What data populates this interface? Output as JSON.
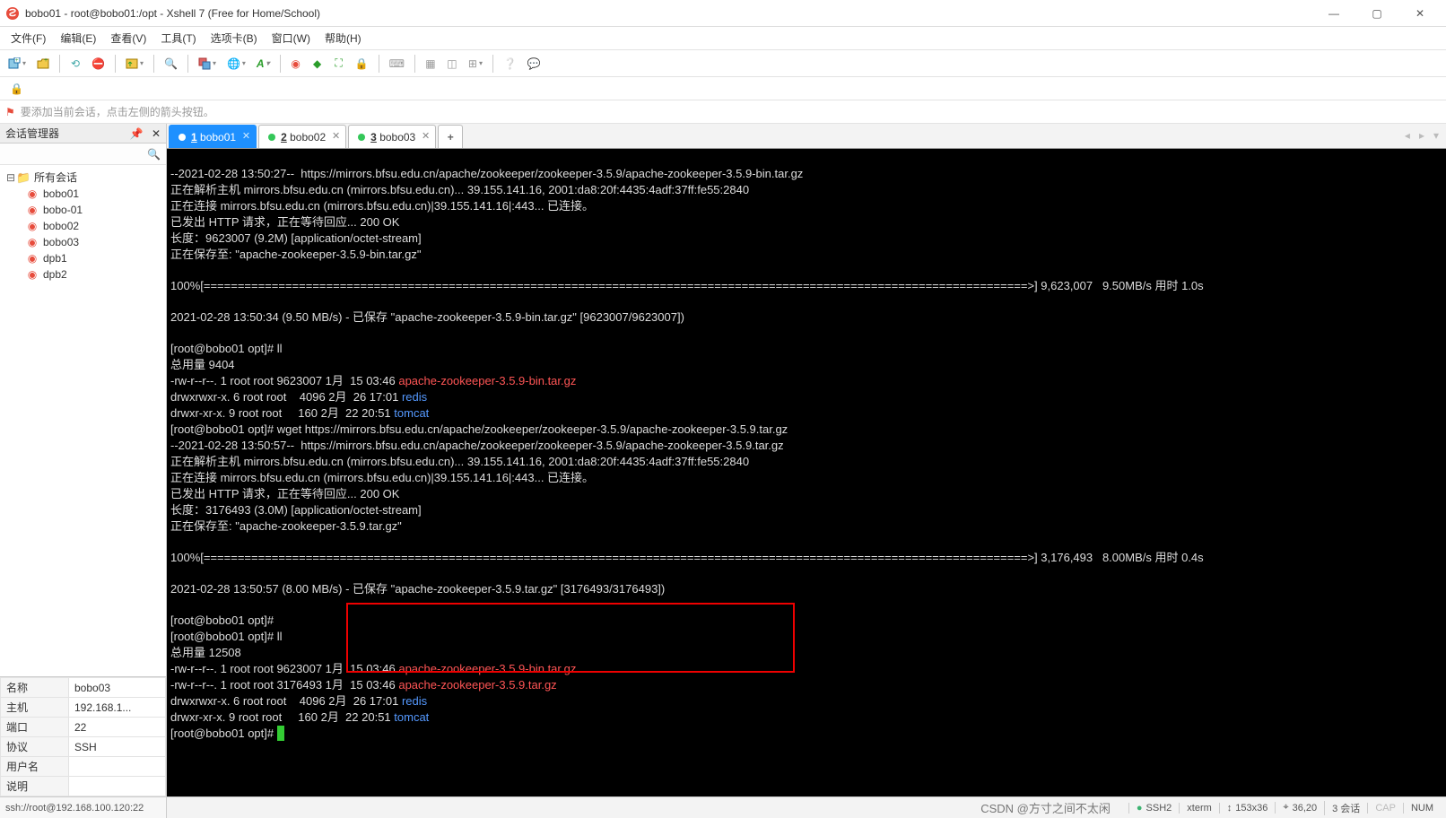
{
  "window": {
    "title": "bobo01 - root@bobo01:/opt - Xshell 7 (Free for Home/School)",
    "min": "—",
    "max": "▢",
    "close": "✕"
  },
  "menu": [
    "文件(F)",
    "编辑(E)",
    "查看(V)",
    "工具(T)",
    "选项卡(B)",
    "窗口(W)",
    "帮助(H)"
  ],
  "tipbar": "要添加当前会话，点击左侧的箭头按钮。",
  "panel": {
    "title": "会话管理器"
  },
  "tree": {
    "root": "所有会话",
    "items": [
      "bobo01",
      "bobo-01",
      "bobo02",
      "bobo03",
      "dpb1",
      "dpb2"
    ]
  },
  "props": {
    "rows": [
      {
        "k": "名称",
        "v": "bobo03"
      },
      {
        "k": "主机",
        "v": "192.168.1..."
      },
      {
        "k": "端口",
        "v": "22"
      },
      {
        "k": "协议",
        "v": "SSH"
      },
      {
        "k": "用户名",
        "v": ""
      },
      {
        "k": "说明",
        "v": ""
      }
    ]
  },
  "tabs": [
    {
      "num": "1",
      "label": "bobo01",
      "active": true
    },
    {
      "num": "2",
      "label": "bobo02",
      "active": false
    },
    {
      "num": "3",
      "label": "bobo03",
      "active": false
    }
  ],
  "term": {
    "l01": "--2021-02-28 13:50:27--  https://mirrors.bfsu.edu.cn/apache/zookeeper/zookeeper-3.5.9/apache-zookeeper-3.5.9-bin.tar.gz",
    "l02": "正在解析主机 mirrors.bfsu.edu.cn (mirrors.bfsu.edu.cn)... 39.155.141.16, 2001:da8:20f:4435:4adf:37ff:fe55:2840",
    "l03": "正在连接 mirrors.bfsu.edu.cn (mirrors.bfsu.edu.cn)|39.155.141.16|:443... 已连接。",
    "l04": "已发出 HTTP 请求，正在等待回应... 200 OK",
    "l05": "长度：9623007 (9.2M) [application/octet-stream]",
    "l06": "正在保存至: \"apache-zookeeper-3.5.9-bin.tar.gz\"",
    "l07": "100%[=========================================================================================================================>] 9,623,007   9.50MB/s 用时 1.0s",
    "l08": "2021-02-28 13:50:34 (9.50 MB/s) - 已保存 \"apache-zookeeper-3.5.9-bin.tar.gz\" [9623007/9623007])",
    "l09": "[root@bobo01 opt]# ll",
    "l10": "总用量 9404",
    "l11a": "-rw-r--r--. 1 root root 9623007 1月  15 03:46 ",
    "l11b": "apache-zookeeper-3.5.9-bin.tar.gz",
    "l12a": "drwxrwxr-x. 6 root root    4096 2月  26 17:01 ",
    "l12b": "redis",
    "l13a": "drwxr-xr-x. 9 root root     160 2月  22 20:51 ",
    "l13b": "tomcat",
    "l14": "[root@bobo01 opt]# wget https://mirrors.bfsu.edu.cn/apache/zookeeper/zookeeper-3.5.9/apache-zookeeper-3.5.9.tar.gz",
    "l15": "--2021-02-28 13:50:57--  https://mirrors.bfsu.edu.cn/apache/zookeeper/zookeeper-3.5.9/apache-zookeeper-3.5.9.tar.gz",
    "l16": "正在解析主机 mirrors.bfsu.edu.cn (mirrors.bfsu.edu.cn)... 39.155.141.16, 2001:da8:20f:4435:4adf:37ff:fe55:2840",
    "l17": "正在连接 mirrors.bfsu.edu.cn (mirrors.bfsu.edu.cn)|39.155.141.16|:443... 已连接。",
    "l18": "已发出 HTTP 请求，正在等待回应... 200 OK",
    "l19": "长度：3176493 (3.0M) [application/octet-stream]",
    "l20": "正在保存至: \"apache-zookeeper-3.5.9.tar.gz\"",
    "l21": "100%[=========================================================================================================================>] 3,176,493   8.00MB/s 用时 0.4s",
    "l22": "2021-02-28 13:50:57 (8.00 MB/s) - 已保存 \"apache-zookeeper-3.5.9.tar.gz\" [3176493/3176493])",
    "l23": "[root@bobo01 opt]#",
    "l24": "[root@bobo01 opt]# ll",
    "l25": "总用量 12508",
    "l26a": "-rw-r--r--. 1 root root 9623007 1月  15 03:46 ",
    "l26b": "apache-zookeeper-3.5.9-bin.tar.gz",
    "l27a": "-rw-r--r--. 1 root root 3176493 1月  15 03:46 ",
    "l27b": "apache-zookeeper-3.5.9.tar.gz",
    "l28a": "drwxrwxr-x. 6 root root    4096 2月  26 17:01 ",
    "l28b": "redis",
    "l29a": "drwxr-xr-x. 9 root root     160 2月  22 20:51 ",
    "l29b": "tomcat",
    "l30": "[root@bobo01 opt]# "
  },
  "status": {
    "left": "ssh://root@192.168.100.120:22",
    "ssh": "SSH2",
    "term": "xterm",
    "size": "153x36",
    "cursor": "36,20",
    "sess": "3 会话",
    "cap": "CAP",
    "num": "NUM",
    "watermark": "CSDN @方寸之间不太闲"
  }
}
